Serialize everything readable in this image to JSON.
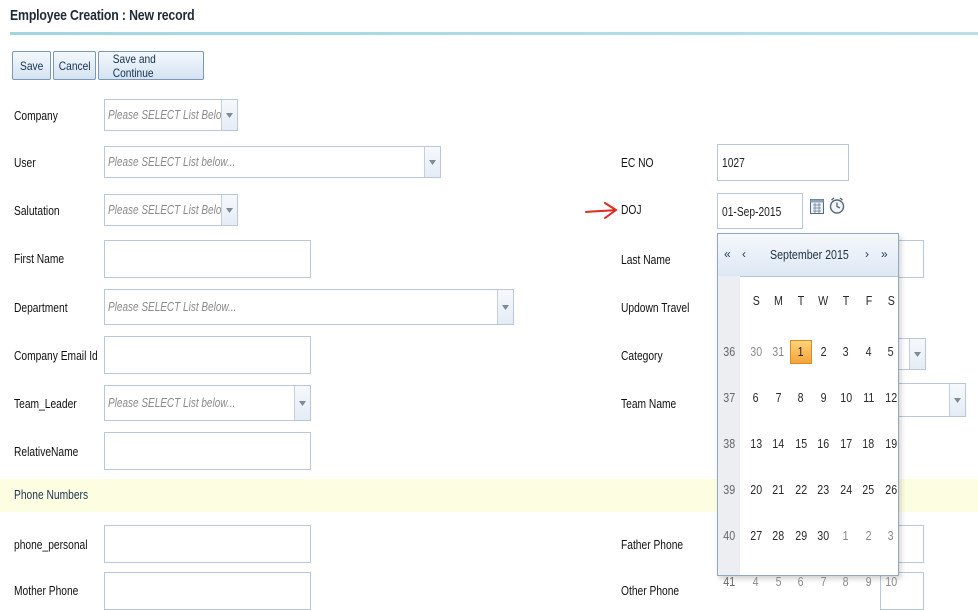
{
  "page": {
    "title": "Employee Creation : New record"
  },
  "toolbar": {
    "save": "Save",
    "cancel": "Cancel",
    "save_continue": "Save and Continue"
  },
  "form": {
    "company": {
      "label": "Company",
      "placeholder": "Please SELECT List Below.."
    },
    "user": {
      "label": "User",
      "placeholder": "Please SELECT List below..."
    },
    "ec_no": {
      "label": "EC NO",
      "value": "1027"
    },
    "salutation": {
      "label": "Salutation",
      "placeholder": "Please SELECT List Below.."
    },
    "doj": {
      "label": "DOJ",
      "value": "01-Sep-2015"
    },
    "first_name": {
      "label": "First Name",
      "value": ""
    },
    "last_name": {
      "label": "Last Name",
      "value": ""
    },
    "department": {
      "label": "Department",
      "placeholder": "Please SELECT List Below..."
    },
    "updown_travel": {
      "label": "Updown Travel"
    },
    "company_email": {
      "label": "Company Email Id",
      "value": ""
    },
    "category": {
      "label": "Category"
    },
    "team_leader": {
      "label": "Team_Leader",
      "placeholder": "Please SELECT List below..."
    },
    "team_name": {
      "label": "Team Name"
    },
    "relative_name": {
      "label": "RelativeName",
      "value": ""
    },
    "phone_section": {
      "label": "Phone Numbers"
    },
    "phone_personal": {
      "label": "phone_personal",
      "value": ""
    },
    "father_phone": {
      "label": "Father Phone",
      "value": ""
    },
    "mother_phone": {
      "label": "Mother Phone",
      "value": ""
    },
    "other_phone": {
      "label": "Other Phone",
      "value": ""
    }
  },
  "calendar": {
    "month": "September 2015",
    "nav": {
      "prev_year": "«",
      "prev_month": "‹",
      "next_month": "›",
      "next_year": "»"
    },
    "weekdays": [
      "S",
      "M",
      "T",
      "W",
      "T",
      "F",
      "S"
    ],
    "weeks": [
      {
        "wk": "36",
        "days": [
          "30",
          "31",
          "1",
          "2",
          "3",
          "4",
          "5"
        ]
      },
      {
        "wk": "37",
        "days": [
          "6",
          "7",
          "8",
          "9",
          "10",
          "11",
          "12"
        ]
      },
      {
        "wk": "38",
        "days": [
          "13",
          "14",
          "15",
          "16",
          "17",
          "18",
          "19"
        ]
      },
      {
        "wk": "39",
        "days": [
          "20",
          "21",
          "22",
          "23",
          "24",
          "25",
          "26"
        ]
      },
      {
        "wk": "40",
        "days": [
          "27",
          "28",
          "29",
          "30",
          "1",
          "2",
          "3"
        ]
      },
      {
        "wk": "41",
        "days": [
          "4",
          "5",
          "6",
          "7",
          "8",
          "9",
          "10"
        ]
      }
    ],
    "selected": "1",
    "colors": {
      "selected": "#f3a53b",
      "header": "#dde8f4"
    }
  },
  "icons": {
    "calendar": "calendar-icon",
    "clock": "clock-icon",
    "dropdown": "chevron-down-icon",
    "annotation": "red-arrow-icon"
  }
}
